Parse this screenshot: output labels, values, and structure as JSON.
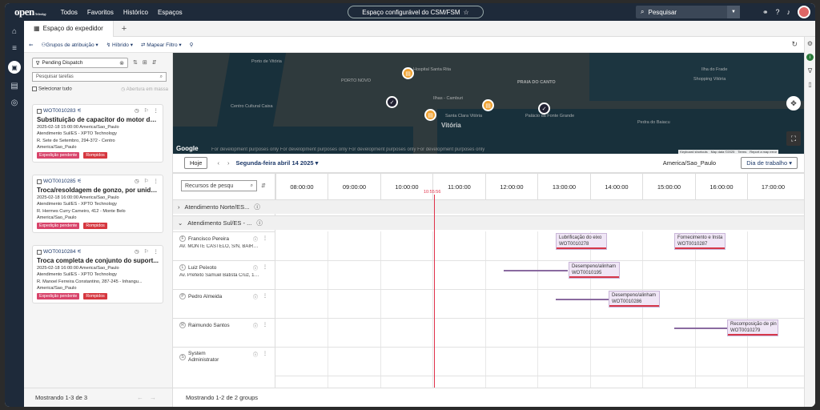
{
  "app": {
    "logo": "open",
    "logo_sub": "Technology"
  },
  "nav": {
    "items": [
      "Todos",
      "Favoritos",
      "Histórico",
      "Espaços"
    ]
  },
  "workspace_title": "Espaço configurável do CSM/FSM",
  "search": {
    "placeholder": "Pesquisar"
  },
  "tabs": {
    "active": "Espaço do expedidor",
    "add": "+"
  },
  "toolbar": {
    "assign_groups": "Grupos de atribuição",
    "hybrid": "Híbrido",
    "map_filter": "Mapear Filtro"
  },
  "sidepanel": {
    "filter": "Pending Dispatch",
    "search_placeholder": "Pesquisar tarefas",
    "select_all": "Selecionar tudo",
    "open_new_tab": "Abertura em massa",
    "footer": "Mostrando 1-3 de 3",
    "cards": [
      {
        "id": "WOT0010283",
        "title": "Substituição de capacitor do motor do...",
        "datetime": "2025-02-18 15:00:00 America/Sao_Paulo",
        "group": "Atendimento Sul/ES - XPTO Technology",
        "address": "R. Sete de Setembro, 294-372 - Centro",
        "tz": "America/Sao_Paulo",
        "badge1": "Expedição pendente",
        "badge2": "Rompidos"
      },
      {
        "id": "WOT0010285",
        "title": "Troca/resoldagem de gonzo, por unida...",
        "datetime": "2025-02-18 16:00:00 America/Sao_Paulo",
        "group": "Atendimento Sul/ES - XPTO Technology",
        "address": "R. Hermes Curry Carneiro, 412 - Monte Belo",
        "tz": "America/Sao_Paulo",
        "badge1": "Expedição pendente",
        "badge2": "Rompidos"
      },
      {
        "id": "WOT0010284",
        "title": "Troca completa de conjunto do suport...",
        "datetime": "2025-02-18 16:00:00 America/Sao_Paulo",
        "group": "Atendimento Sul/ES - XPTO Technology",
        "address": "R. Manoel Ferreira Constantino, 287-245 - Inhangu...",
        "tz": "America/Sao_Paulo",
        "badge1": "Expedição pendente",
        "badge2": "Rompidos"
      }
    ]
  },
  "map": {
    "labels": [
      "Vitória",
      "PRAIA DO CANTO",
      "Hospital Santa Rita",
      "Santa Clara Vitória",
      "Centro Cultural Caixa",
      "Porto Santana",
      "Ilha de Santa Maria",
      "Shopping Vitória",
      "Ilha do Frade",
      "Ilhas - Camburi",
      "PORTO NOVO",
      "Palácio da Fonte Grande",
      "Porto de Vitória",
      "Pedra do Baiacu"
    ],
    "brand": "Google",
    "dev_msg": "For development purposes only     For development purposes only     For development purposes only     For development purposes only",
    "attribution": [
      "Keyboard shortcuts",
      "Map data ©2025",
      "Terms",
      "Report a map error"
    ]
  },
  "schedule": {
    "today": "Hoje",
    "date": "Segunda-feira abril 14 2025",
    "timezone": "America/Sao_Paulo",
    "view": "Dia de trabalho",
    "resource_search": "Recursos de pesqu",
    "hours": [
      "08:00:00",
      "09:00:00",
      "10:00:00",
      "11:00:00",
      "12:00:00",
      "13:00:00",
      "14:00:00",
      "15:00:00",
      "16:00:00",
      "17:00:00"
    ],
    "now": "10:55:56",
    "groups": [
      "Atendimento Norte/ES...",
      "Atendimento Sul/ES - ..."
    ],
    "resources": [
      {
        "ini": "F",
        "name": "Francisco Pereira",
        "addr": "AV. MONTE CASTELO, S/N, BAIRR..."
      },
      {
        "ini": "L",
        "name": "Luiz Peixoto",
        "addr": "Av. Prefeito Samuel Batista Cruz, 10..."
      },
      {
        "ini": "P",
        "name": "Pedro Almeida",
        "addr": ""
      },
      {
        "ini": "R",
        "name": "Raimundo Santos",
        "addr": ""
      },
      {
        "ini": "S",
        "name": "System Administrator",
        "addr": ""
      }
    ],
    "events": [
      {
        "title": "Lubrificação do eixo",
        "id": "WOT0010278"
      },
      {
        "title": "Fornecimento e Insta",
        "id": "WOT0010287"
      },
      {
        "title": "Desempeno/alinham",
        "id": "WOT0010195"
      },
      {
        "title": "Desempeno/alinham",
        "id": "WOT0010286"
      },
      {
        "title": "Recomposição de pin",
        "id": "WOT0010279"
      }
    ],
    "footer": "Mostrando 1-2 de 2 groups"
  }
}
